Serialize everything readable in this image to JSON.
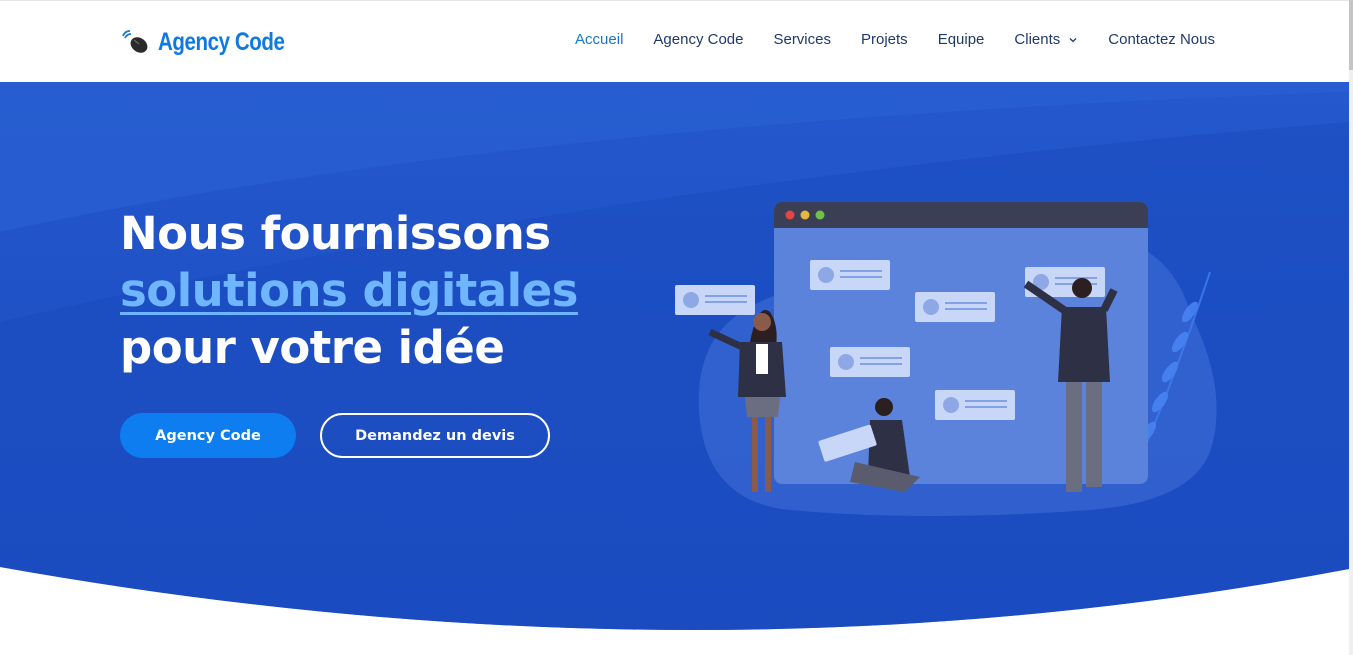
{
  "header": {
    "logo_text": "Agency Code",
    "nav": [
      {
        "label": "Accueil",
        "active": true
      },
      {
        "label": "Agency Code",
        "active": false
      },
      {
        "label": "Services",
        "active": false
      },
      {
        "label": "Projets",
        "active": false
      },
      {
        "label": "Equipe",
        "active": false
      },
      {
        "label": "Clients",
        "active": false,
        "has_dropdown": true
      },
      {
        "label": "Contactez Nous",
        "active": false
      }
    ]
  },
  "hero": {
    "headline_line1": "Nous fournissons",
    "headline_line2": "solutions digitales",
    "headline_line3": "pour votre idée",
    "primary_button": "Agency Code",
    "secondary_button": "Demandez un devis"
  },
  "colors": {
    "brand_blue": "#0d7ae0",
    "hero_blue": "#1d4fc4",
    "accent_text": "#6fb6ff",
    "nav_text": "#1f3a69",
    "nav_active": "#1478d4"
  },
  "icons": {
    "logo": "mouse-logo-icon",
    "dropdown": "chevron-down-icon"
  }
}
